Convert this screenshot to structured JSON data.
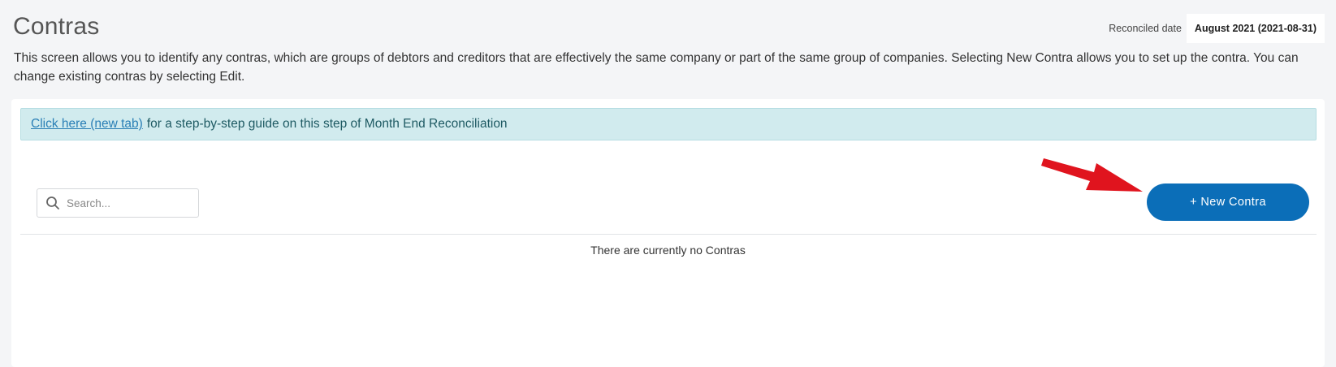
{
  "page": {
    "title": "Contras",
    "reconciled_label": "Reconciled date",
    "reconciled_value": "August 2021 (2021-08-31)",
    "description": "This screen allows you to identify any contras, which are groups of debtors and creditors that are effectively the same company or part of the same group of companies. Selecting New Contra allows you to set up the contra. You can change existing contras by selecting Edit."
  },
  "guide": {
    "link_text": "Click here (new tab)",
    "text": "for a step-by-step guide on this step of Month End Reconciliation"
  },
  "search": {
    "placeholder": "Search...",
    "value": ""
  },
  "toolbar": {
    "new_contra_label": "+ New Contra"
  },
  "table": {
    "empty_message": "There are currently no Contras"
  },
  "icons": {
    "search": "search-icon",
    "annotation_arrow": "arrow-right-icon"
  },
  "colors": {
    "primary": "#0b6eb8",
    "banner_bg": "#d1ebee",
    "link": "#2a7fb6",
    "annotation_arrow": "#e0141e"
  }
}
